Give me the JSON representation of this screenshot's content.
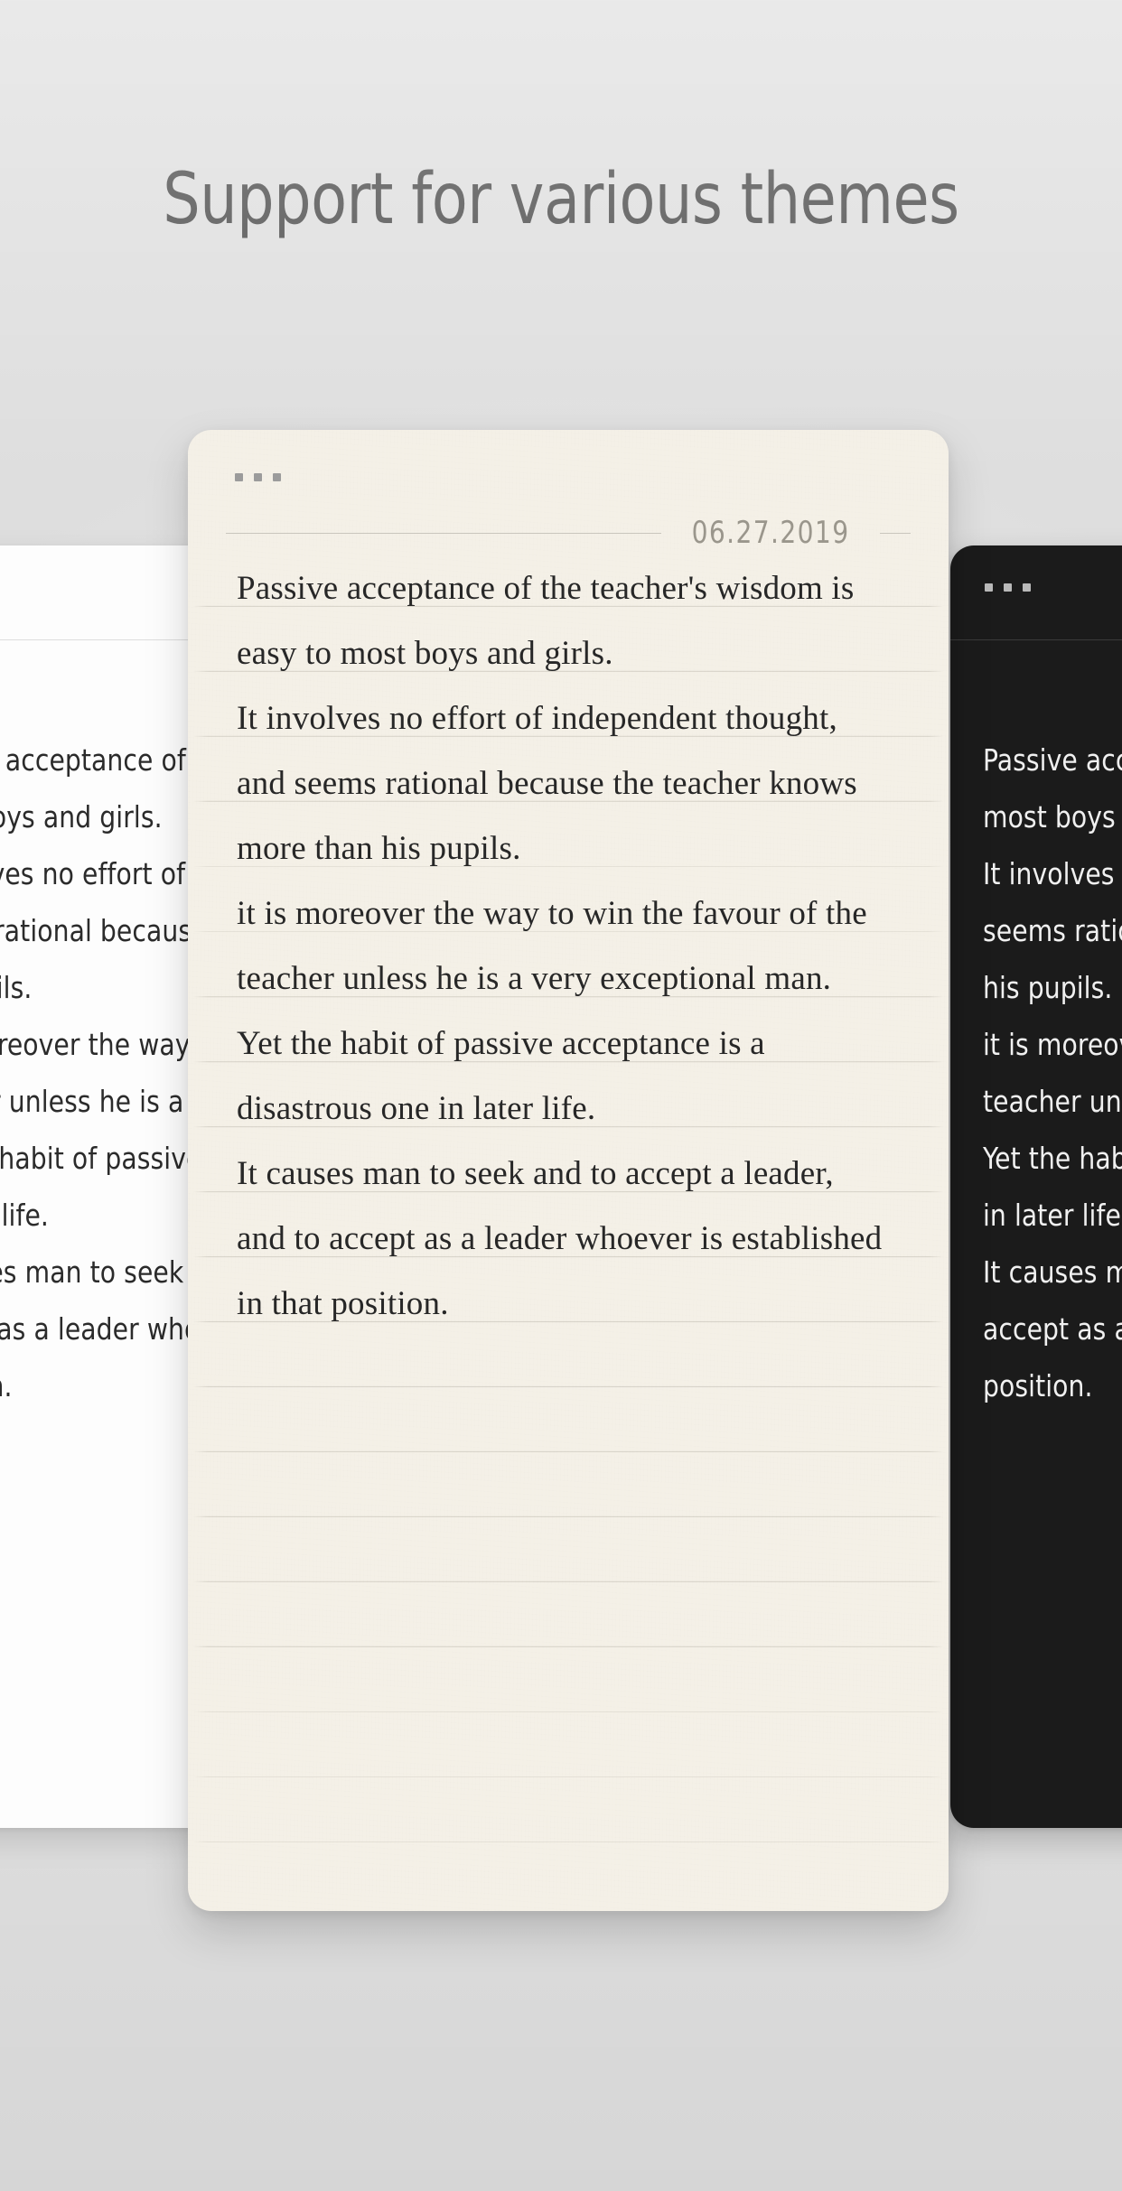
{
  "page": {
    "title": "Support for various themes",
    "background_color": "#e4e4e4",
    "title_color": "#4c4c4c"
  },
  "cards": {
    "center": {
      "theme_name": "paper",
      "background_color": "#f4f0e7",
      "text_color": "#272727",
      "date": "06.27.2019",
      "window_dots": [
        "dot",
        "dot",
        "dot"
      ],
      "lines": [
        "Passive acceptance of the teacher's wisdom is",
        "easy to most boys and girls.",
        "It involves no effort of independent thought,",
        "and seems rational because the teacher knows",
        "more than his pupils.",
        "it is moreover the way to win the favour of the",
        "teacher unless he is a very exceptional man.",
        "Yet the habit of passive acceptance is a",
        "disastrous one in later life.",
        "It causes man to seek and to accept a leader,",
        "and to accept as a leader whoever is established",
        "in that position."
      ]
    },
    "left": {
      "theme_name": "light",
      "background_color": "#fdfdfd",
      "text_color": "#2b2b2b",
      "window_dots": [
        "dot",
        "dot",
        "dot"
      ],
      "lines": [
        "Passive acceptance of the teacher's wisdom is easy to",
        "most boys and girls.",
        "It involves no effort of independent thought, and",
        "seems rational because the teacher knows more than",
        "his pupils.",
        "it is moreover the way to win the favour of the",
        "teacher unless he is a very exceptional man.",
        "Yet the habit of passive acceptance is a disastrous one",
        "in later life.",
        "It causes man to seek and to accept a leader, and to",
        "accept as a leader whoever is established in that",
        "position."
      ]
    },
    "right": {
      "theme_name": "dark",
      "background_color": "#1b1b1b",
      "text_color": "#f0f0f0",
      "window_dots": [
        "dot",
        "dot",
        "dot"
      ],
      "lines": [
        "Passive acceptance of the teacher's wisdom is easy to",
        "most boys and girls.",
        "It involves no effort of independent thought, and",
        "seems rational because the teacher knows more than",
        "his pupils.",
        "it is moreover the way to win the favour of the",
        "teacher unless he is a very exceptional man.",
        "Yet the habit of passive acceptance is a disastrous one",
        "in later life.",
        "It causes man to seek and to accept a leader, and to",
        "accept as a leader whoever is established in that",
        "position."
      ]
    }
  }
}
